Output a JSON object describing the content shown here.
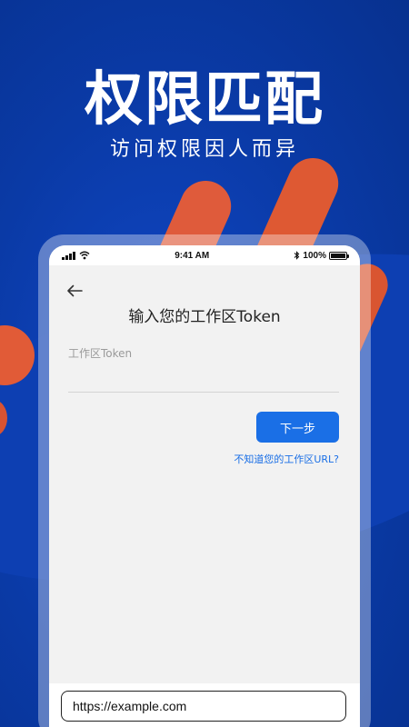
{
  "promo": {
    "headline": "权限匹配",
    "subline": "访问权限因人而异"
  },
  "status_bar": {
    "time": "9:41 AM",
    "battery": "100%",
    "icons": [
      "signal-icon",
      "wifi-icon",
      "bluetooth-icon",
      "battery-icon"
    ]
  },
  "screen": {
    "back_icon": "arrow-left-icon",
    "title": "输入您的工作区Token",
    "field_label": "工作区Token",
    "field_value": "",
    "next_label": "下一步",
    "help_link": "不知道您的工作区URL?"
  },
  "url_bar": {
    "value": "https://example.com"
  },
  "colors": {
    "background": "#0a3aa6",
    "accent_orange": "#e05a35",
    "primary_button": "#1a6fe6",
    "screen_bg": "#f2f2f2"
  }
}
